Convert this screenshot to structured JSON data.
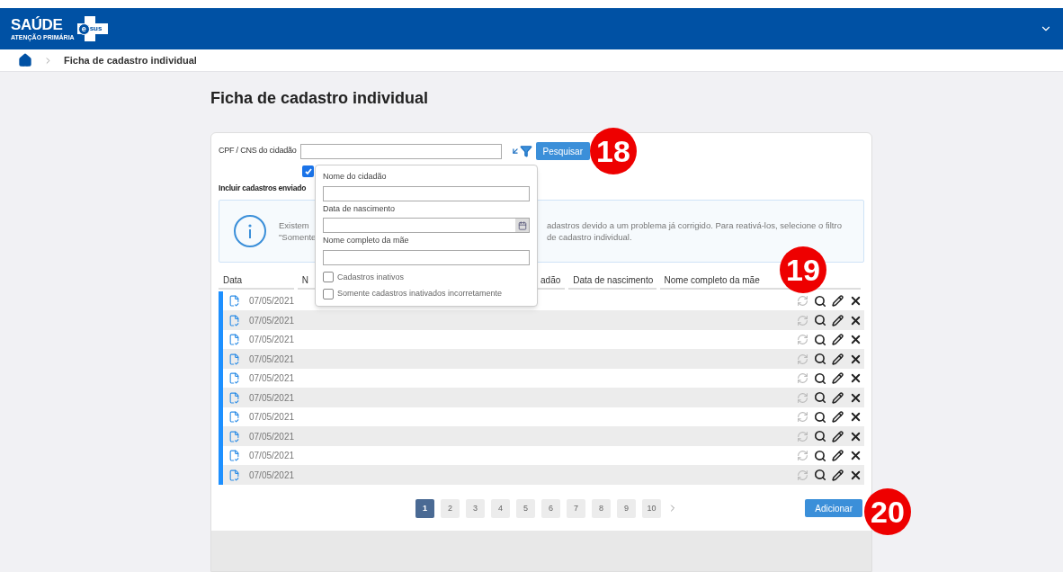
{
  "header": {
    "logo": {
      "name": "SAÚDE",
      "mark_letter": "e",
      "mark_word": "sus",
      "subtitle": "ATENÇÃO PRIMÁRIA"
    }
  },
  "breadcrumb": {
    "current": "Ficha de cadastro individual"
  },
  "page_title": "Ficha de cadastro individual",
  "search": {
    "label": "CPF / CNS do cidadão",
    "button": "Pesquisar",
    "include_checked": true,
    "include_label": "Incluir cadastros enviado"
  },
  "info": {
    "line1_left": "Existem",
    "line1_right": "adastros devido a um problema já corrigido. Para reativá-los, selecione o filtro",
    "line2_left": "\"Somente",
    "line2_right": "de cadastro individual."
  },
  "filter_popover": {
    "fields": [
      {
        "kind": "text",
        "label": "Nome do cidadão"
      },
      {
        "kind": "date",
        "label": "Data de nascimento"
      },
      {
        "kind": "text",
        "label": "Nome completo da mãe"
      }
    ],
    "options": [
      {
        "label": "Cadastros inativos",
        "checked": false
      },
      {
        "label": "Somente cadastros inativados incorretamente",
        "checked": false
      }
    ]
  },
  "table": {
    "columns": [
      "Data",
      "N",
      "adão",
      "Data de nascimento",
      "Nome completo da mãe"
    ],
    "rows": [
      {
        "date": "07/05/2021"
      },
      {
        "date": "07/05/2021"
      },
      {
        "date": "07/05/2021"
      },
      {
        "date": "07/05/2021"
      },
      {
        "date": "07/05/2021"
      },
      {
        "date": "07/05/2021"
      },
      {
        "date": "07/05/2021"
      },
      {
        "date": "07/05/2021"
      },
      {
        "date": "07/05/2021"
      },
      {
        "date": "07/05/2021"
      }
    ]
  },
  "pagination": [
    {
      "label": "1",
      "selected": true
    },
    {
      "label": "2",
      "selected": false
    },
    {
      "label": "3",
      "selected": false
    },
    {
      "label": "4",
      "selected": false
    },
    {
      "label": "5",
      "selected": false
    },
    {
      "label": "6",
      "selected": false
    },
    {
      "label": "7",
      "selected": false
    },
    {
      "label": "8",
      "selected": false
    },
    {
      "label": "9",
      "selected": false
    },
    {
      "label": "10",
      "selected": false
    }
  ],
  "add_button": "Adicionar",
  "callouts": [
    "18",
    "19",
    "20"
  ]
}
